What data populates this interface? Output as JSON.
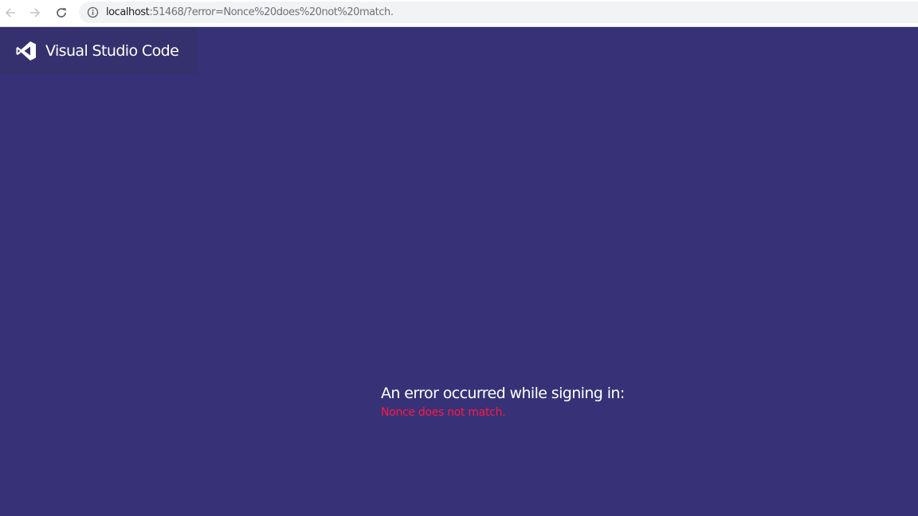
{
  "browser": {
    "back_icon": "arrow-left-icon",
    "forward_icon": "arrow-right-icon",
    "reload_icon": "reload-icon",
    "info_icon": "info-circle-icon",
    "url_host": "localhost",
    "url_rest": ":51468/?error=Nonce%20does%20not%20match."
  },
  "header": {
    "logo_icon": "visual-studio-code-logo",
    "title": "Visual Studio Code"
  },
  "error": {
    "heading": "An error occurred while signing in:",
    "message": "Nonce does not match."
  },
  "colors": {
    "page_background": "#373277",
    "header_band": "#35316f",
    "error_text": "#ff1744",
    "heading_text": "#ffffff"
  }
}
